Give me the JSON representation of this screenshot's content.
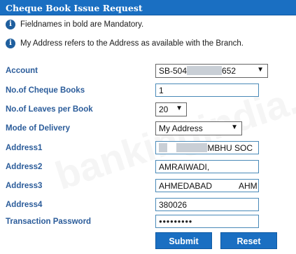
{
  "header": {
    "title": "Cheque Book Issue Request"
  },
  "info": [
    "Fieldnames in bold are Mandatory.",
    "My Address refers to the Address as available with the Branch."
  ],
  "form": {
    "account": {
      "label": "Account",
      "value_prefix": "SB-504",
      "value_suffix": "652"
    },
    "cheque_books": {
      "label": "No.of Cheque Books",
      "value": "1"
    },
    "leaves": {
      "label": "No.of Leaves per Book",
      "value": "20"
    },
    "delivery": {
      "label": "Mode of Delivery",
      "value": "My Address"
    },
    "address1": {
      "label": "Address1",
      "value": "MBHU SOC"
    },
    "address2": {
      "label": "Address2",
      "value": "AMRAIWADI,"
    },
    "address3": {
      "label": "Address3",
      "value_left": "AHMEDABAD",
      "value_right": "AHM"
    },
    "address4": {
      "label": "Address4",
      "value": "380026"
    },
    "password": {
      "label": "Transaction Password",
      "value": "●●●●●●●●●"
    }
  },
  "buttons": {
    "submit": "Submit",
    "reset": "Reset"
  },
  "watermark": "bankingindia.org",
  "colors": {
    "header": "#1a6fc2",
    "label": "#2b5c9a",
    "button": "#1a6fc2"
  },
  "icons": {
    "info": "info-icon",
    "dropdown": "triangle-down-icon"
  }
}
